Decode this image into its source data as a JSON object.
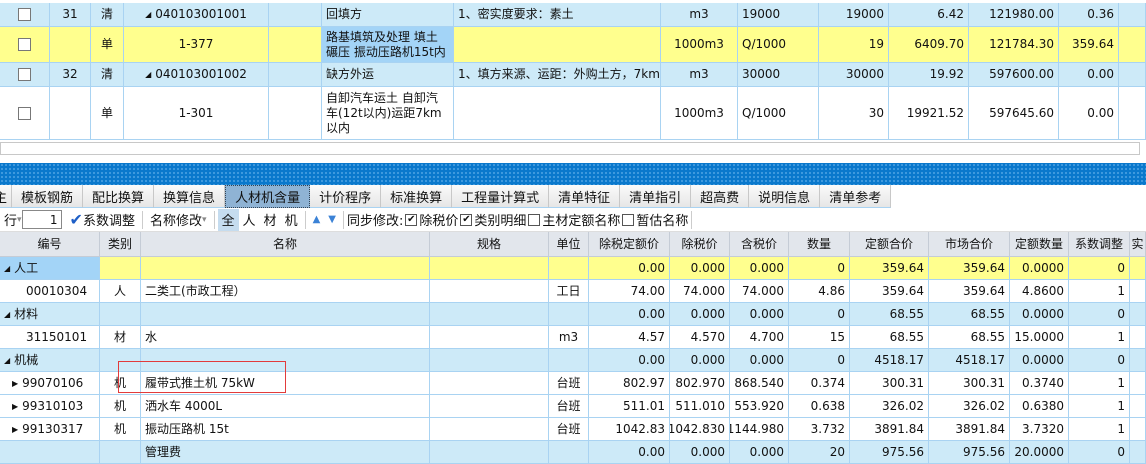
{
  "top_rows": [
    {
      "style": "blue",
      "seq": "31",
      "type": "清",
      "code": "040103001001",
      "expand": true,
      "name": "回填方",
      "feature": "1、密实度要求：素土",
      "unit": "m3",
      "expr": "19000",
      "qty": "19000",
      "price": "6.42",
      "total": "121980.00",
      "extra": "0.36"
    },
    {
      "style": "yellow",
      "seq": "",
      "type": "单",
      "code": "1-377",
      "expand": false,
      "name": "路基填筑及处理 填土碾压 振动压路机15t内",
      "feature": "",
      "unit": "1000m3",
      "expr": "Q/1000",
      "qty": "19",
      "price": "6409.70",
      "total": "121784.30",
      "extra": "359.64"
    },
    {
      "style": "blue",
      "seq": "32",
      "type": "清",
      "code": "040103001002",
      "expand": true,
      "name": "缺方外运",
      "feature": "1、填方来源、运距：外购土方，7km",
      "unit": "m3",
      "expr": "30000",
      "qty": "30000",
      "price": "19.92",
      "total": "597600.00",
      "extra": "0.00"
    },
    {
      "style": "white",
      "seq": "",
      "type": "单",
      "code": "1-301",
      "expand": false,
      "name": "自卸汽车运土 自卸汽车(12t以内)运距7km以内",
      "feature": "",
      "unit": "1000m3",
      "expr": "Q/1000",
      "qty": "30",
      "price": "19921.52",
      "total": "597645.60",
      "extra": "0.00"
    }
  ],
  "tabs": [
    "主",
    "模板钢筋",
    "配比换算",
    "换算信息",
    "人材机含量",
    "计价程序",
    "标准换算",
    "工程量计算式",
    "清单特征",
    "清单指引",
    "超高费",
    "说明信息",
    "清单参考"
  ],
  "active_tab": "人材机含量",
  "toolbar": {
    "row_label": "行",
    "row_value": "1",
    "coef_adjust": "系数调整",
    "name_modify": "名称修改",
    "filters": [
      "全",
      "人",
      "材",
      "机"
    ],
    "sync_label": "同步修改:",
    "checks": [
      {
        "label": "除税价",
        "checked": true
      },
      {
        "label": "类别明细",
        "checked": true
      },
      {
        "label": "主材定额名称",
        "checked": false
      },
      {
        "label": "暂估名称",
        "checked": false
      }
    ]
  },
  "bottom_headers": [
    "编号",
    "类别",
    "名称",
    "规格",
    "单位",
    "除税定额价",
    "除税价",
    "含税价",
    "数量",
    "定额合价",
    "市场合价",
    "定额数量",
    "系数调整",
    "实"
  ],
  "bottom_rows": [
    {
      "style": "yellow",
      "group": true,
      "code": "人工",
      "cat": "",
      "name": "",
      "spec": "",
      "unit": "",
      "v": [
        "0.00",
        "0.000",
        "0.000",
        "0",
        "359.64",
        "359.64",
        "0.0000",
        "0"
      ]
    },
    {
      "style": "white",
      "code": "00010304",
      "cat": "人",
      "name": "二类工(市政工程）",
      "spec": "",
      "unit": "工日",
      "v": [
        "74.00",
        "74.000",
        "74.000",
        "4.86",
        "359.64",
        "359.64",
        "4.8600",
        "1"
      ]
    },
    {
      "style": "blue",
      "group": true,
      "code": "材料",
      "cat": "",
      "name": "",
      "spec": "",
      "unit": "",
      "v": [
        "0.00",
        "0.000",
        "0.000",
        "0",
        "68.55",
        "68.55",
        "0.0000",
        "0"
      ]
    },
    {
      "style": "white",
      "code": "31150101",
      "cat": "材",
      "name": "水",
      "spec": "",
      "unit": "m3",
      "v": [
        "4.57",
        "4.570",
        "4.700",
        "15",
        "68.55",
        "68.55",
        "15.0000",
        "1"
      ]
    },
    {
      "style": "blue",
      "group": true,
      "code": "机械",
      "cat": "",
      "name": "",
      "spec": "",
      "unit": "",
      "v": [
        "0.00",
        "0.000",
        "0.000",
        "0",
        "4518.17",
        "4518.17",
        "0.0000",
        "0"
      ]
    },
    {
      "style": "white",
      "child": true,
      "code": "99070106",
      "cat": "机",
      "name": "履带式推土机 75kW",
      "spec": "",
      "unit": "台班",
      "v": [
        "802.97",
        "802.970",
        "868.540",
        "0.374",
        "300.31",
        "300.31",
        "0.3740",
        "1"
      ]
    },
    {
      "style": "white",
      "child": true,
      "code": "99310103",
      "cat": "机",
      "name": "洒水车 4000L",
      "spec": "",
      "unit": "台班",
      "v": [
        "511.01",
        "511.010",
        "553.920",
        "0.638",
        "326.02",
        "326.02",
        "0.6380",
        "1"
      ]
    },
    {
      "style": "white",
      "child": true,
      "code": "99130317",
      "cat": "机",
      "name": "振动压路机 15t",
      "spec": "",
      "unit": "台班",
      "v": [
        "1042.83",
        "1042.830",
        "1144.980",
        "3.732",
        "3891.84",
        "3891.84",
        "3.7320",
        "1"
      ]
    },
    {
      "style": "blue",
      "code": "",
      "cat": "",
      "name": "管理费",
      "spec": "",
      "unit": "",
      "v": [
        "0.00",
        "0.000",
        "0.000",
        "20",
        "975.56",
        "975.56",
        "20.0000",
        "0"
      ]
    }
  ],
  "colors": {
    "row_blue": "#cdeaf8",
    "row_yellow": "#ffff8e",
    "selected": "#a3d4f7",
    "bar_blue": "#0a78cc",
    "highlight_box": "#e23b3b"
  }
}
